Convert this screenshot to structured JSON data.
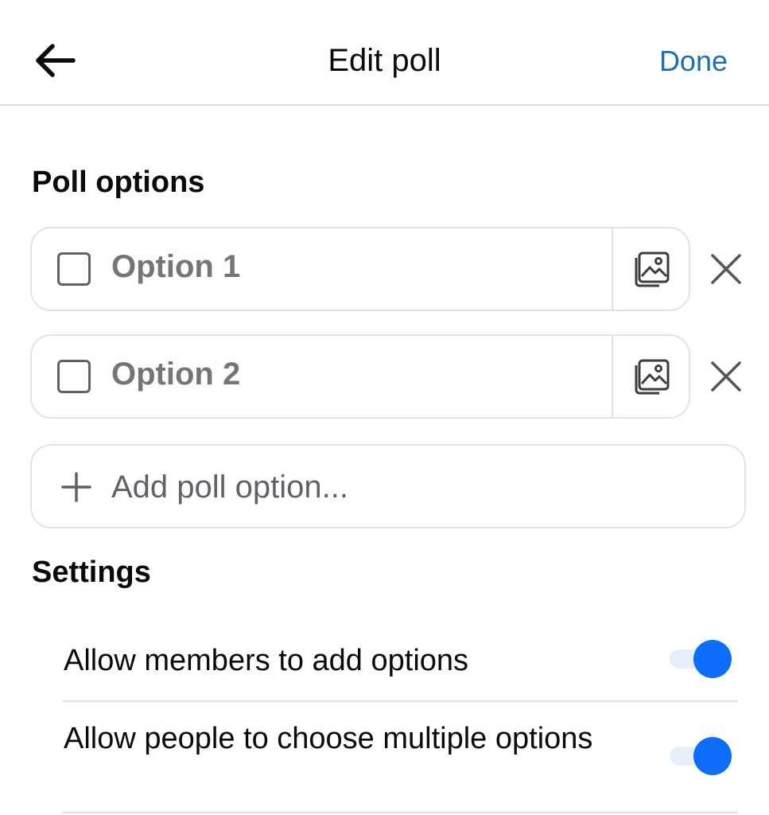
{
  "header": {
    "title": "Edit poll",
    "done_label": "Done"
  },
  "poll_options": {
    "section_title": "Poll options",
    "items": [
      {
        "placeholder": "Option 1"
      },
      {
        "placeholder": "Option 2"
      }
    ],
    "add_label": "Add poll option..."
  },
  "settings": {
    "section_title": "Settings",
    "items": [
      {
        "label": "Allow members to add options",
        "enabled": true
      },
      {
        "label": "Allow people to choose multiple options",
        "enabled": true
      }
    ]
  },
  "icons": {
    "back": "arrow-left-icon",
    "image": "add-image-icon",
    "remove": "close-icon",
    "add": "plus-icon"
  },
  "colors": {
    "accent": "#0d6efd",
    "done_link": "#1b6fb5",
    "placeholder_text": "#5f6368"
  }
}
